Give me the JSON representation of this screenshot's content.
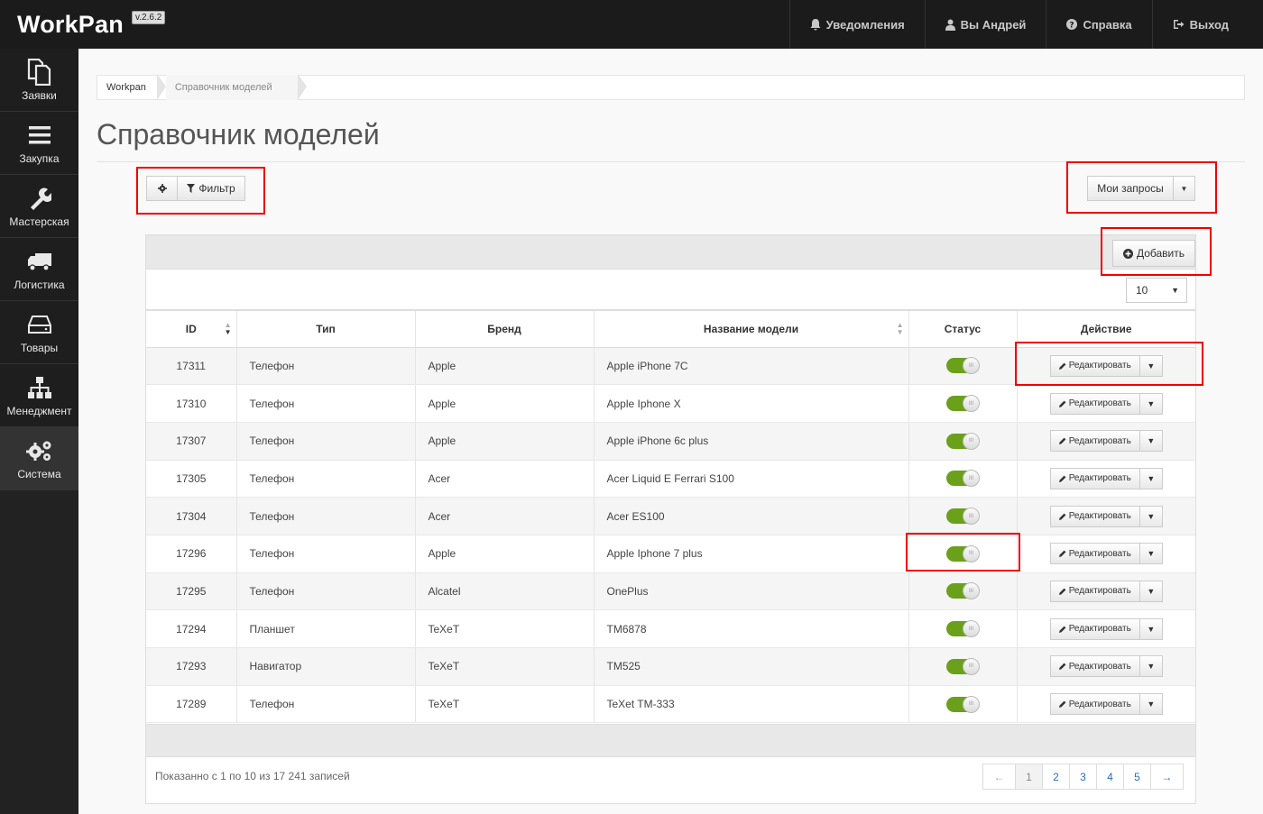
{
  "app": {
    "name": "WorkPan",
    "version": "v.2.6.2"
  },
  "topnav": [
    {
      "label": "Уведомления",
      "icon": "bell-icon"
    },
    {
      "label": "Вы Андрей",
      "icon": "user-icon"
    },
    {
      "label": "Справка",
      "icon": "help-icon"
    },
    {
      "label": "Выход",
      "icon": "logout-icon"
    }
  ],
  "sidebar": [
    {
      "label": "Заявки",
      "icon": "documents-icon"
    },
    {
      "label": "Закупка",
      "icon": "menu-icon"
    },
    {
      "label": "Мастерская",
      "icon": "wrench-icon"
    },
    {
      "label": "Логистика",
      "icon": "truck-icon"
    },
    {
      "label": "Товары",
      "icon": "drive-icon"
    },
    {
      "label": "Менеджмент",
      "icon": "sitemap-icon"
    },
    {
      "label": "Система",
      "icon": "gears-icon",
      "active": true
    }
  ],
  "breadcrumb": [
    "Workpan",
    "Справочник моделей"
  ],
  "page": {
    "title": "Справочник моделей"
  },
  "toolbar": {
    "filter_label": "Фильтр",
    "my_requests_label": "Мои запросы",
    "add_label": "Добавить"
  },
  "table": {
    "page_length": "10",
    "columns": [
      "ID",
      "Тип",
      "Бренд",
      "Название модели",
      "Статус",
      "Действие"
    ],
    "edit_label": "Редактировать",
    "rows": [
      {
        "id": "17311",
        "type": "Телефон",
        "brand": "Apple",
        "model": "Apple iPhone 7C",
        "status": true
      },
      {
        "id": "17310",
        "type": "Телефон",
        "brand": "Apple",
        "model": "Apple Iphone X",
        "status": true
      },
      {
        "id": "17307",
        "type": "Телефон",
        "brand": "Apple",
        "model": "Apple iPhone 6c plus",
        "status": true
      },
      {
        "id": "17305",
        "type": "Телефон",
        "brand": "Acer",
        "model": "Acer Liquid E Ferrari S100",
        "status": true
      },
      {
        "id": "17304",
        "type": "Телефон",
        "brand": "Acer",
        "model": "Acer ES100",
        "status": true
      },
      {
        "id": "17296",
        "type": "Телефон",
        "brand": "Apple",
        "model": "Apple Iphone 7 plus",
        "status": true
      },
      {
        "id": "17295",
        "type": "Телефон",
        "brand": "Alcatel",
        "model": "OnePlus",
        "status": true
      },
      {
        "id": "17294",
        "type": "Планшет",
        "brand": "TeXeT",
        "model": "TM6878",
        "status": true
      },
      {
        "id": "17293",
        "type": "Навигатор",
        "brand": "TeXeT",
        "model": "TM525",
        "status": true
      },
      {
        "id": "17289",
        "type": "Телефон",
        "brand": "TeXeT",
        "model": "TeXet TM-333",
        "status": true
      }
    ],
    "info": "Показанно с 1 по 10 из 17 241 записей"
  },
  "pagination": {
    "prev": "←",
    "next": "→",
    "pages": [
      "1",
      "2",
      "3",
      "4",
      "5"
    ],
    "current": "1"
  },
  "colors": {
    "topbar": "#1b1b1b",
    "sidebar": "#222222",
    "toggle_on": "#6aa01a",
    "highlight": "#ee0000",
    "link": "#2a6ebb"
  }
}
